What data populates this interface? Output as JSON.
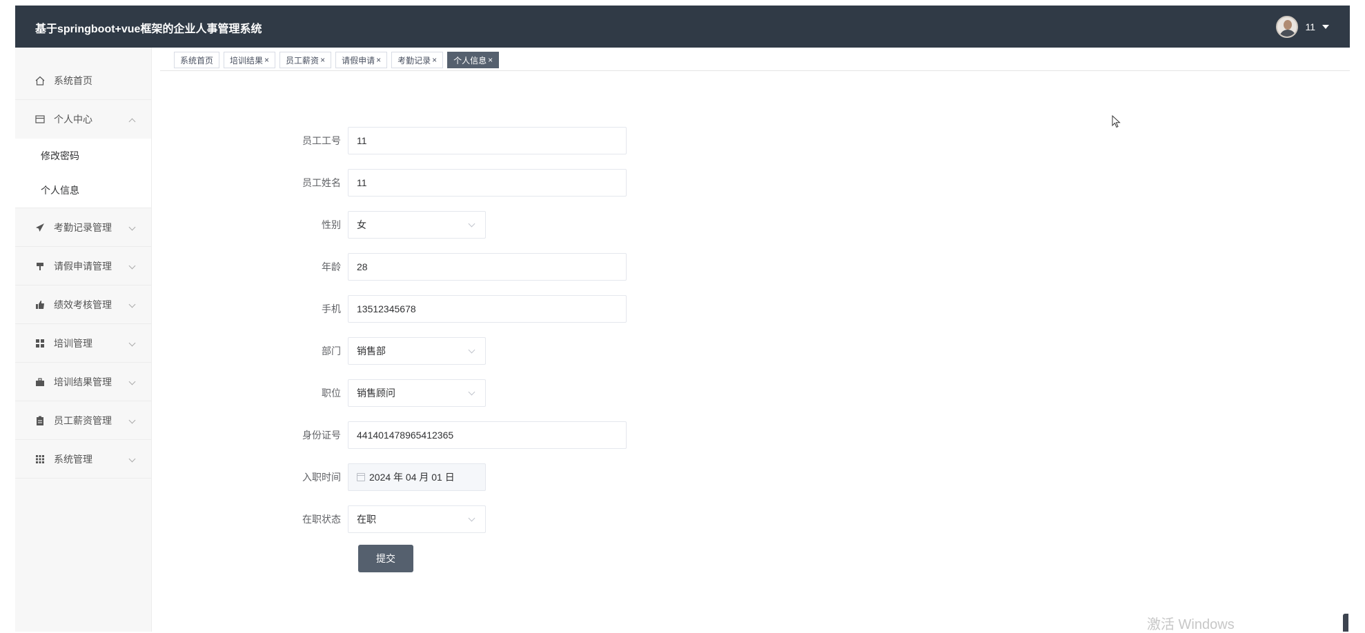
{
  "header": {
    "title": "基于springboot+vue框架的企业人事管理系统",
    "user_name": "11"
  },
  "sidebar": {
    "home": "系统首页",
    "personal_center": "个人中心",
    "personal_sub": [
      "修改密码",
      "个人信息"
    ],
    "items": [
      {
        "label": "考勤记录管理",
        "icon": "paper-plane-icon"
      },
      {
        "label": "请假申请管理",
        "icon": "signpost-icon"
      },
      {
        "label": "绩效考核管理",
        "icon": "thumbs-up-icon"
      },
      {
        "label": "培训管理",
        "icon": "grid-icon"
      },
      {
        "label": "培训结果管理",
        "icon": "briefcase-icon"
      },
      {
        "label": "员工薪资管理",
        "icon": "clipboard-icon"
      },
      {
        "label": "系统管理",
        "icon": "apps-icon"
      }
    ]
  },
  "tabs": [
    {
      "label": "系统首页",
      "closable": false
    },
    {
      "label": "培训结果",
      "closable": true
    },
    {
      "label": "员工薪资",
      "closable": true
    },
    {
      "label": "请假申请",
      "closable": true
    },
    {
      "label": "考勤记录",
      "closable": true
    },
    {
      "label": "个人信息",
      "closable": true,
      "active": true
    }
  ],
  "form": {
    "employee_no": {
      "label": "员工工号",
      "value": "11"
    },
    "employee_name": {
      "label": "员工姓名",
      "value": "11"
    },
    "gender": {
      "label": "性别",
      "value": "女"
    },
    "age": {
      "label": "年龄",
      "value": "28"
    },
    "phone": {
      "label": "手机",
      "value": "13512345678"
    },
    "department": {
      "label": "部门",
      "value": "销售部"
    },
    "position": {
      "label": "职位",
      "value": "销售顾问"
    },
    "id_number": {
      "label": "身份证号",
      "value": "441401478965412365"
    },
    "hire_date": {
      "label": "入职时间",
      "value": "2024 年 04 月 01 日"
    },
    "status": {
      "label": "在职状态",
      "value": "在职"
    },
    "submit_label": "提交"
  },
  "watermark": "激活 Windows",
  "colors": {
    "header_bg": "#303a46",
    "accent": "#55606e"
  }
}
